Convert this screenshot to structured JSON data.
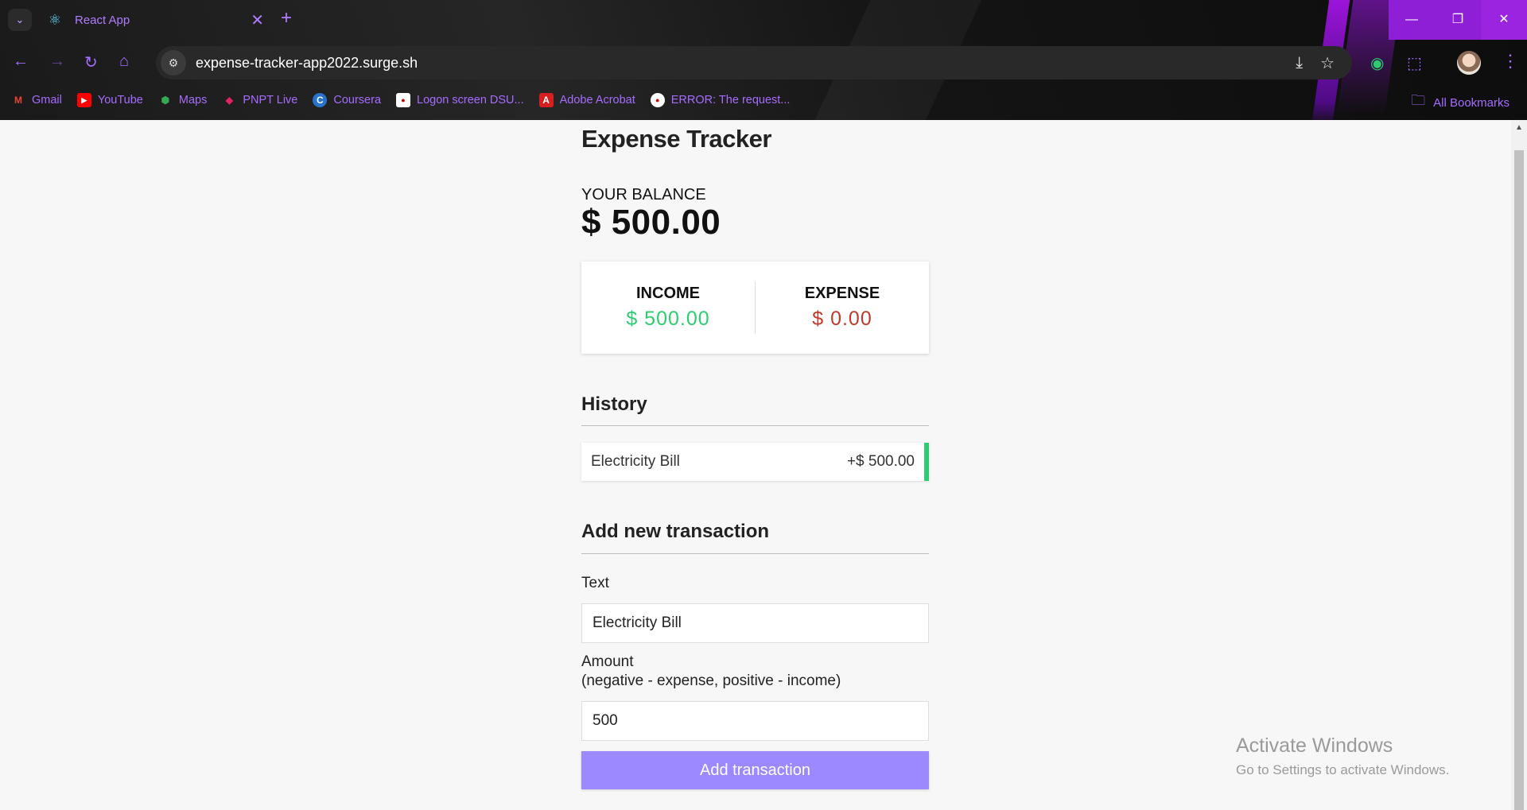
{
  "browser": {
    "tab_title": "React App",
    "url": "expense-tracker-app2022.surge.sh",
    "bookmarks": [
      {
        "label": "Gmail",
        "icon": "gmail-icon"
      },
      {
        "label": "YouTube",
        "icon": "youtube-icon"
      },
      {
        "label": "Maps",
        "icon": "maps-icon"
      },
      {
        "label": "PNPT Live",
        "icon": "pnpt-icon"
      },
      {
        "label": "Coursera",
        "icon": "coursera-icon"
      },
      {
        "label": "Logon screen DSU...",
        "icon": "dsu-icon"
      },
      {
        "label": "Adobe Acrobat",
        "icon": "acrobat-icon"
      },
      {
        "label": "ERROR: The request...",
        "icon": "error-page-icon"
      }
    ],
    "all_bookmarks": "All Bookmarks"
  },
  "app": {
    "title": "Expense Tracker",
    "balance_label": "YOUR BALANCE",
    "balance_value": "$ 500.00",
    "income_label": "INCOME",
    "income_value": "$ 500.00",
    "expense_label": "EXPENSE",
    "expense_value": "$ 0.00",
    "history_title": "History",
    "history": [
      {
        "text": "Electricity Bill",
        "amount": "+$ 500.00"
      }
    ],
    "add_title": "Add new transaction",
    "text_label": "Text",
    "text_value": "Electricity Bill",
    "amount_label_1": "Amount",
    "amount_label_2": "(negative - expense, positive - income)",
    "amount_value": "500",
    "add_button": "Add transaction"
  },
  "watermark": {
    "line1": "Activate Windows",
    "line2": "Go to Settings to activate Windows."
  },
  "colors": {
    "income": "#2ecc71",
    "expense": "#c0392b",
    "button": "#9c88ff",
    "browser_accent": "#a66cff"
  }
}
